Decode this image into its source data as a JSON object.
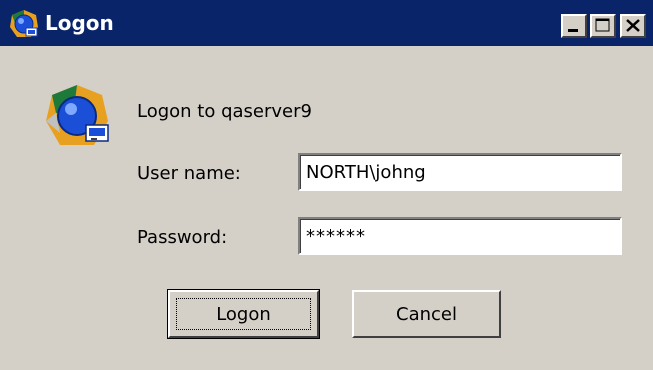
{
  "window": {
    "title": "Logon",
    "title_icon": "logon-app-icon",
    "controls": {
      "minimize_icon": "minimize-icon",
      "maximize_icon": "maximize-icon",
      "close_icon": "close-icon"
    }
  },
  "dialog": {
    "app_icon": "logon-app-icon",
    "heading": "Logon to qaserver9",
    "username_label": "User name:",
    "username_value": "NORTH\\johng",
    "password_label": "Password:",
    "password_value": "******",
    "logon_button": "Logon",
    "cancel_button": "Cancel"
  },
  "colors": {
    "titlebar": "#0a246a",
    "dialog_bg": "#d4d0c8"
  }
}
